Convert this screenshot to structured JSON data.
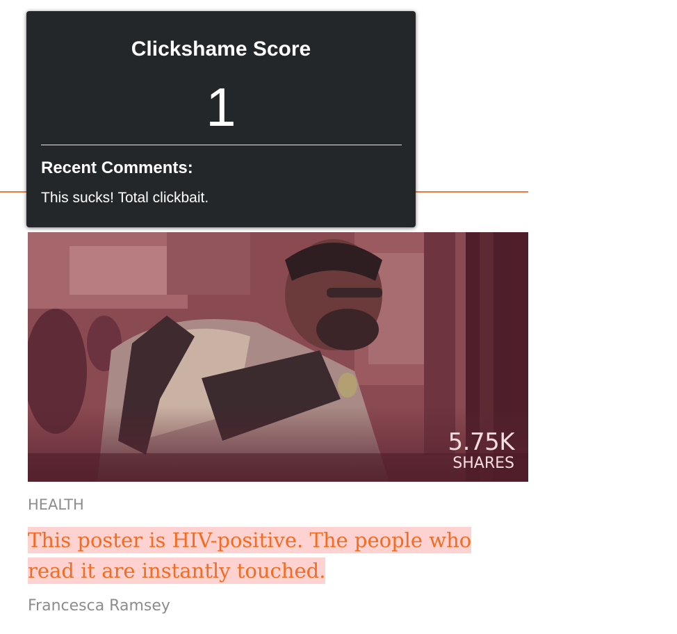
{
  "popup": {
    "title": "Clickshame Score",
    "score": "1",
    "comments_heading": "Recent Comments:",
    "comments": [
      "This sucks! Total clickbait."
    ]
  },
  "article": {
    "shares_count": "5.75K",
    "shares_label": "SHARES",
    "category": "HEALTH",
    "headline": "This poster is HIV-positive. The people who read it are instantly touched.",
    "author": "Francesca Ramsey"
  },
  "colors": {
    "accent": "#f26c22",
    "highlight": "#ffd2d2",
    "popup_bg": "#232729"
  }
}
